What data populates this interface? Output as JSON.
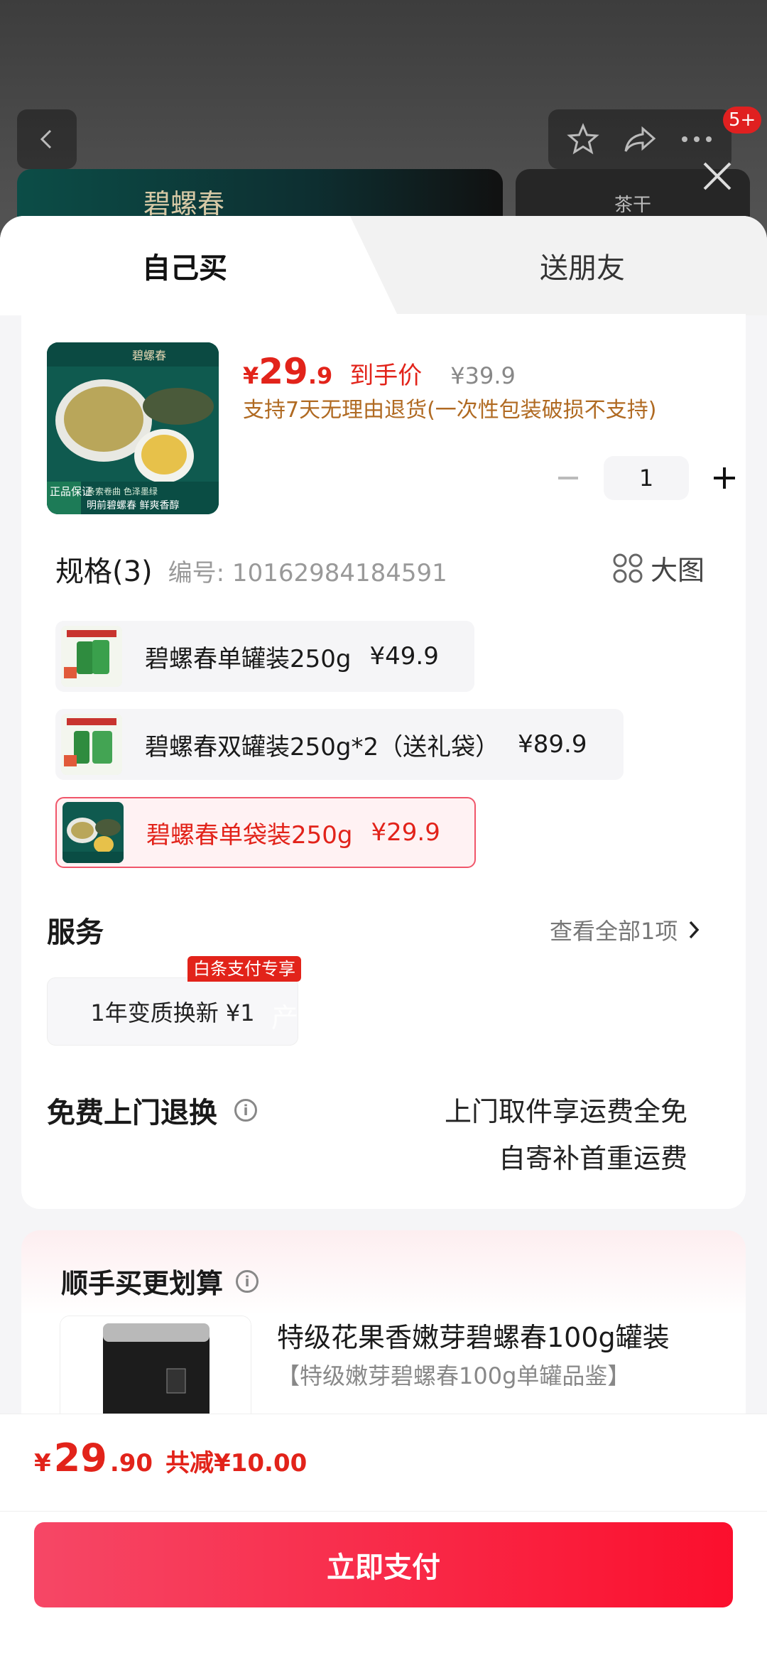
{
  "background": {
    "badge": "5+",
    "banner_brand": "碧螺春",
    "banner_tag": "茶干"
  },
  "tabs": {
    "self": "自己买",
    "gift": "送朋友"
  },
  "product": {
    "price_symbol": "¥",
    "price_int": "29",
    "price_dec": ".9",
    "price_label": "到手价",
    "original_price": "¥39.9",
    "return_note": "支持7天无理由退货(一次性包装破损不支持)",
    "quantity": "1",
    "image_labels": {
      "brand": "碧螺春",
      "cert": "正品保证",
      "slogan": "明前碧螺春 鲜爽香醇",
      "sub": "条索卷曲 色泽墨绿"
    }
  },
  "spec": {
    "title": "规格(3)",
    "code": "编号: 10162984184591",
    "big_image": "大图",
    "options": [
      {
        "name": "碧螺春单罐装250g",
        "price": "¥49.9"
      },
      {
        "name": "碧螺春双罐装250g*2（送礼袋）",
        "price": "¥89.9"
      },
      {
        "name": "碧螺春单袋装250g",
        "price": "¥29.9"
      }
    ]
  },
  "watermark": "产品性能优势",
  "service": {
    "title": "服务",
    "view_all": "查看全部1项",
    "pill": "1年变质换新  ¥1",
    "tag": "白条支付专享"
  },
  "free_return": {
    "title": "免费上门退换",
    "line1": "上门取件享运费全免",
    "line2": "自寄补首重运费"
  },
  "extra": {
    "title": "顺手买更划算",
    "name": "特级花果香嫩芽碧螺春100g罐装",
    "sub": "【特级嫩芽碧螺春100g单罐品鉴】"
  },
  "footer": {
    "price_symbol": "¥",
    "price_int": "29",
    "price_dec": ".90",
    "saving": "共减¥10.00",
    "pay_button": "立即支付"
  },
  "colors": {
    "accent": "#e2231a",
    "note": "#b06a22"
  }
}
